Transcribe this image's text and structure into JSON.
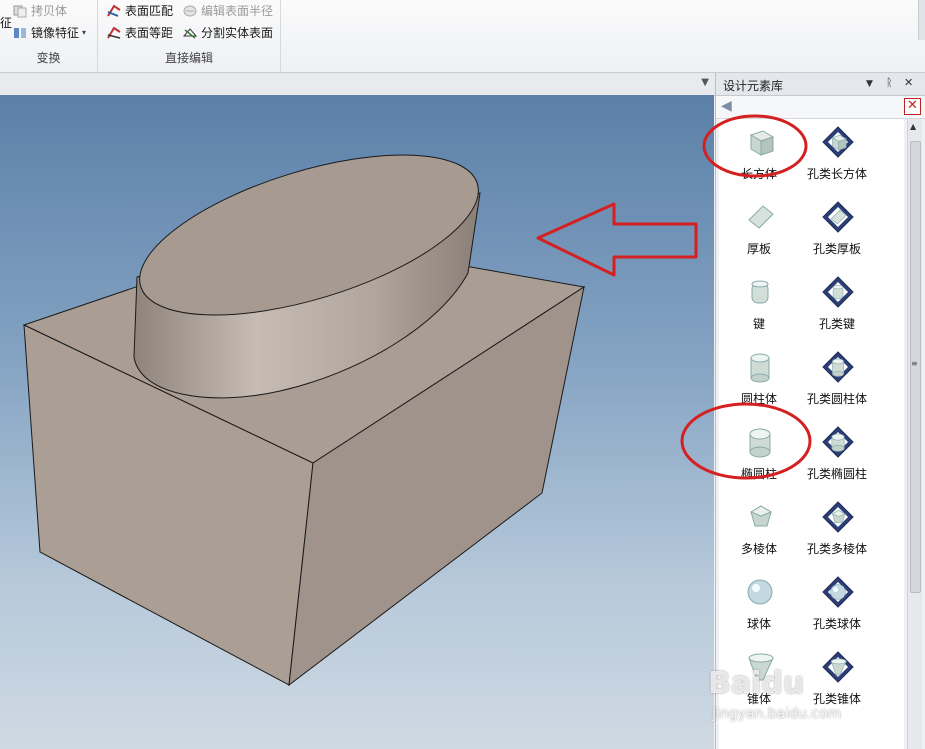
{
  "ribbon": {
    "fragment": "征",
    "transform_group": {
      "label": "变换",
      "copy_body": "拷贝体",
      "mirror_feature": "镜像特征"
    },
    "direct_edit_group": {
      "label": "直接编辑",
      "surface_match": "表面匹配",
      "edit_surface_radius": "编辑表面半径",
      "surface_offset": "表面等距",
      "split_solid_surface": "分割实体表面"
    }
  },
  "panel": {
    "title": "设计元素库",
    "items": [
      {
        "label": "长方体",
        "icon": "box-solid-icon"
      },
      {
        "label": "孔类长方体",
        "icon": "box-hole-icon"
      },
      {
        "label": "厚板",
        "icon": "plate-solid-icon"
      },
      {
        "label": "孔类厚板",
        "icon": "plate-hole-icon"
      },
      {
        "label": "键",
        "icon": "key-solid-icon"
      },
      {
        "label": "孔类键",
        "icon": "key-hole-icon"
      },
      {
        "label": "圆柱体",
        "icon": "cylinder-solid-icon"
      },
      {
        "label": "孔类圆柱体",
        "icon": "cylinder-hole-icon"
      },
      {
        "label": "椭圆柱",
        "icon": "elliptic-cylinder-solid-icon"
      },
      {
        "label": "孔类椭圆柱",
        "icon": "elliptic-cylinder-hole-icon"
      },
      {
        "label": "多棱体",
        "icon": "prism-solid-icon"
      },
      {
        "label": "孔类多棱体",
        "icon": "prism-hole-icon"
      },
      {
        "label": "球体",
        "icon": "sphere-solid-icon"
      },
      {
        "label": "孔类球体",
        "icon": "sphere-hole-icon"
      },
      {
        "label": "锥体",
        "icon": "cone-solid-icon"
      },
      {
        "label": "孔类锥体",
        "icon": "cone-hole-icon"
      }
    ]
  },
  "watermark": {
    "logo": "Baidu",
    "url": "jingyan.baidu.com"
  },
  "colors": {
    "annotation_red": "#d42020",
    "model_face": "#a79b92",
    "viewport_top": "#5b80a8"
  }
}
